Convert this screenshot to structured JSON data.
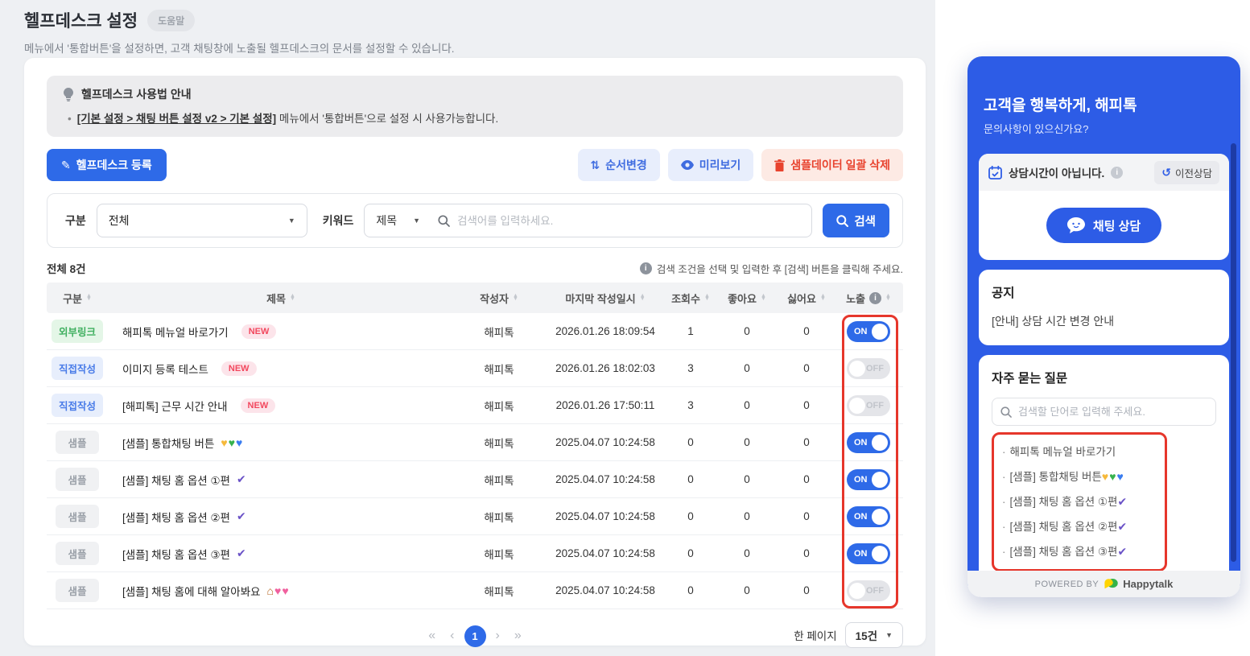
{
  "page": {
    "title": "헬프데스크 설정",
    "help_badge": "도움말",
    "subtitle": "메뉴에서 '통합버튼'을 설정하면, 고객 채팅창에 노출될 헬프데스크의 문서를 설정할 수 있습니다."
  },
  "info_box": {
    "title": "헬프데스크 사용법 안내",
    "bullet_link": "[기본 설정 > 채팅 버튼 설정 v2 > 기본 설정]",
    "bullet_rest": " 메뉴에서 '통합버튼'으로 설정 시 사용가능합니다."
  },
  "toolbar": {
    "register_label": "헬프데스크 등록",
    "reorder_label": "순서변경",
    "preview_label": "미리보기",
    "delete_samples_label": "샘플데이터 일괄 삭제"
  },
  "filters": {
    "category_label": "구분",
    "category_value": "전체",
    "keyword_label": "키워드",
    "keyword_field_value": "제목",
    "search_placeholder": "검색어를 입력하세요.",
    "search_button_label": "검색"
  },
  "summary": {
    "total": "전체 8건",
    "hint": "검색 조건을 선택 및 입력한 후 [검색] 버튼을 클릭해 주세요."
  },
  "table": {
    "headers": [
      "구분",
      "제목",
      "작성자",
      "마지막 작성일시",
      "조회수",
      "좋아요",
      "싫어요",
      "노출"
    ],
    "toggle_on_label": "ON",
    "toggle_off_label": "OFF",
    "new_label": "NEW",
    "rows": [
      {
        "badge": "외부링크",
        "badge_type": "green",
        "title": "해피톡 메뉴얼 바로가기",
        "is_new": true,
        "icons": [],
        "author": "해피톡",
        "date": "2026.01.26 18:09:54",
        "views": "1",
        "likes": "0",
        "dislikes": "0",
        "exposed": true
      },
      {
        "badge": "직접작성",
        "badge_type": "blue",
        "title": "이미지 등록 테스트",
        "is_new": true,
        "icons": [],
        "author": "해피톡",
        "date": "2026.01.26 18:02:03",
        "views": "3",
        "likes": "0",
        "dislikes": "0",
        "exposed": false
      },
      {
        "badge": "직접작성",
        "badge_type": "blue",
        "title": "[해피톡] 근무 시간 안내",
        "is_new": true,
        "icons": [],
        "author": "해피톡",
        "date": "2026.01.26 17:50:11",
        "views": "3",
        "likes": "0",
        "dislikes": "0",
        "exposed": false
      },
      {
        "badge": "샘플",
        "badge_type": "gray",
        "title": "[샘플] 통합채팅 버튼",
        "is_new": false,
        "icons": [
          "heart-yellow-icon",
          "heart-green-icon",
          "heart-blue-icon"
        ],
        "author": "해피톡",
        "date": "2025.04.07 10:24:58",
        "views": "0",
        "likes": "0",
        "dislikes": "0",
        "exposed": true
      },
      {
        "badge": "샘플",
        "badge_type": "gray",
        "title": "[샘플] 채팅 홈 옵션 ①편",
        "is_new": false,
        "icons": [
          "check-purple-icon"
        ],
        "author": "해피톡",
        "date": "2025.04.07 10:24:58",
        "views": "0",
        "likes": "0",
        "dislikes": "0",
        "exposed": true
      },
      {
        "badge": "샘플",
        "badge_type": "gray",
        "title": "[샘플] 채팅 홈 옵션 ②편",
        "is_new": false,
        "icons": [
          "check-purple-icon"
        ],
        "author": "해피톡",
        "date": "2025.04.07 10:24:58",
        "views": "0",
        "likes": "0",
        "dislikes": "0",
        "exposed": true
      },
      {
        "badge": "샘플",
        "badge_type": "gray",
        "title": "[샘플] 채팅 홈 옵션 ③편",
        "is_new": false,
        "icons": [
          "check-purple-icon"
        ],
        "author": "해피톡",
        "date": "2025.04.07 10:24:58",
        "views": "0",
        "likes": "0",
        "dislikes": "0",
        "exposed": true
      },
      {
        "badge": "샘플",
        "badge_type": "gray",
        "title": "[샘플] 채팅 홈에 대해 알아봐요",
        "is_new": false,
        "icons": [
          "home-icon",
          "two-hearts-icon"
        ],
        "author": "해피톡",
        "date": "2025.04.07 10:24:58",
        "views": "0",
        "likes": "0",
        "dislikes": "0",
        "exposed": false
      }
    ]
  },
  "pagination": {
    "first": "«",
    "prev": "‹",
    "current_page": "1",
    "next": "›",
    "last": "»",
    "per_page_label": "한 페이지",
    "per_page_value": "15건"
  },
  "widget": {
    "title": "고객을 행복하게, 해피톡",
    "subtitle": "문의사항이 있으신가요?",
    "status_text": "상담시간이 아닙니다.",
    "history_label": "이전상담",
    "chat_button_label": "채팅 상담",
    "notice_title": "공지",
    "notice_item": "[안내] 상담 시간 변경 안내",
    "faq_title": "자주 묻는 질문",
    "faq_placeholder": "검색할 단어로 입력해 주세요.",
    "faq_items": [
      {
        "text": "해피톡 메뉴얼 바로가기",
        "icons": []
      },
      {
        "text": "[샘플] 통합채팅 버튼",
        "icons": [
          "heart-yellow-icon",
          "heart-green-icon",
          "heart-blue-icon"
        ]
      },
      {
        "text": "[샘플] 채팅 홈 옵션 ①편",
        "icons": [
          "check-purple-icon"
        ]
      },
      {
        "text": "[샘플] 채팅 홈 옵션 ②편",
        "icons": [
          "check-purple-icon"
        ]
      },
      {
        "text": "[샘플] 채팅 홈 옵션 ③편",
        "icons": [
          "check-purple-icon"
        ]
      }
    ],
    "powered_by": "POWERED BY",
    "brand": "Happytalk"
  },
  "colors": {
    "primary_blue": "#2e6ae8",
    "widget_blue": "#2d5ce6",
    "highlight_red": "#e6362b",
    "badge_green_text": "#3faf5f",
    "badge_blue_text": "#4a7ce8",
    "toggle_off_bg": "#e4e5e9"
  }
}
